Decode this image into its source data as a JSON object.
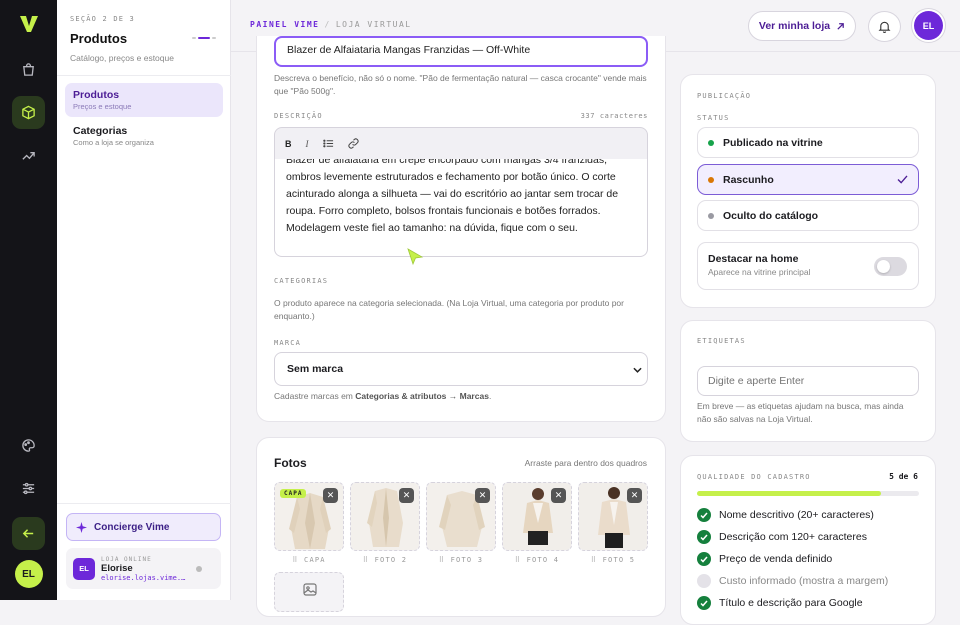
{
  "rail": {
    "brand": "V",
    "avatar_initials": "EL"
  },
  "sidebar": {
    "step_label": "SEÇÃO 2 DE 3",
    "title": "Produtos",
    "subtitle": "Catálogo, preços e estoque",
    "items": [
      {
        "label": "Produtos",
        "sub": "Preços e estoque"
      },
      {
        "label": "Categorias",
        "sub": "Como a loja se organiza"
      }
    ],
    "concierge_label": "Concierge Vime",
    "store": {
      "kicker": "LOJA ONLINE",
      "initials": "EL",
      "name": "Elorise",
      "url": "elorise.lojas.vime.di…"
    }
  },
  "header": {
    "crumb_primary": "PAINEL VIME",
    "crumb_sep": "/",
    "crumb_secondary": "LOJA VIRTUAL",
    "view_store_label": "Ver minha loja",
    "avatar_initials": "EL"
  },
  "form": {
    "title_value": "Blazer de Alfaiataria Mangas Franzidas — Off-White",
    "title_help": "Descreva o benefício, não só o nome. \"Pão de fermentação natural — casca crocante\" vende mais que \"Pão 500g\".",
    "description_label": "DESCRIÇÃO",
    "description_count": "337 caracteres",
    "toolbar": {
      "bold": "B",
      "italic": "I"
    },
    "description_text": "Blazer de alfaiataria em crepe encorpado com mangas 3/4 franzidas, ombros levemente estruturados e fechamento por botão único. O corte acinturado alonga a silhueta — vai do escritório ao jantar sem trocar de roupa. Forro completo, bolsos frontais funcionais e botões forrados. Modelagem veste fiel ao tamanho: na dúvida, fique com o seu.",
    "categories_label": "CATEGORIAS",
    "categories_help": "O produto aparece na categoria selecionada. (Na Loja Virtual, uma categoria por produto por enquanto.)",
    "brand_label": "MARCA",
    "brand_value": "Sem marca",
    "brand_help_prefix": "Cadastre marcas em ",
    "brand_help_link": "Categorias & atributos → Marcas",
    "brand_help_suffix": "."
  },
  "photos": {
    "title": "Fotos",
    "hint": "Arraste para dentro dos quadros",
    "cover_badge": "CAPA",
    "labels": [
      "CAPA",
      "FOTO 2",
      "FOTO 3",
      "FOTO 4",
      "FOTO 5"
    ]
  },
  "publication": {
    "section_label": "PUBLICAÇÃO",
    "status_label": "STATUS",
    "options": [
      {
        "label": "Publicado na vitrine",
        "color": "#16a34a"
      },
      {
        "label": "Rascunho",
        "color": "#d97706"
      },
      {
        "label": "Oculto do catálogo",
        "color": "#9a9aa2"
      }
    ],
    "selected": "Rascunho",
    "highlight_title": "Destacar na home",
    "highlight_sub": "Aparece na vitrine principal",
    "highlight_on": false
  },
  "tags": {
    "label": "ETIQUETAS",
    "placeholder": "Digite e aperte Enter",
    "help": "Em breve — as etiquetas ajudam na busca, mas ainda não são salvas na Loja Virtual."
  },
  "quality": {
    "label": "QUALIDADE DO CADASTRO",
    "score": "5 de 6",
    "progress": 0.83,
    "items": [
      {
        "label": "Nome descritivo (20+ caracteres)",
        "done": true
      },
      {
        "label": "Descrição com 120+ caracteres",
        "done": true
      },
      {
        "label": "Preço de venda definido",
        "done": true
      },
      {
        "label": "Custo informado (mostra a margem)",
        "done": false
      },
      {
        "label": "Título e descrição para Google",
        "done": true
      }
    ]
  },
  "colors": {
    "accent": "#6d28d9",
    "lime": "#c5f04a",
    "rail": "#141418"
  }
}
